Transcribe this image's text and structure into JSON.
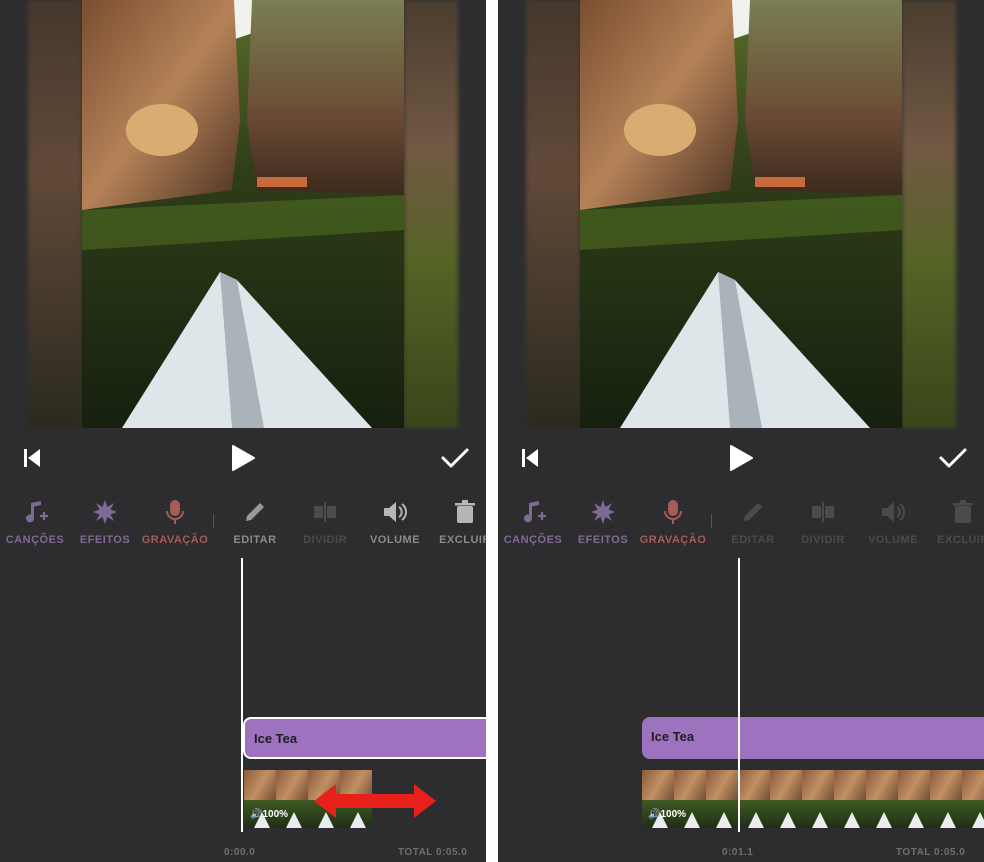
{
  "playback": {
    "skip_icon": "skip-to-start-icon",
    "play_icon": "play-icon",
    "done_icon": "checkmark-icon"
  },
  "toolbar": {
    "items": [
      {
        "label": "CANÇÕES",
        "icon": "music-note-add-icon"
      },
      {
        "label": "EFEITOS",
        "icon": "sparkle-star-icon"
      },
      {
        "label": "GRAVAÇÃO",
        "icon": "microphone-icon"
      },
      {
        "label": "EDITAR",
        "icon": "pencil-icon"
      },
      {
        "label": "DIVIDIR",
        "icon": "split-icon"
      },
      {
        "label": "VOLUME",
        "icon": "speaker-icon"
      },
      {
        "label": "EXCLUIR",
        "icon": "trash-icon"
      }
    ]
  },
  "left_screen": {
    "song_title": "Ice Tea",
    "clip_volume": "🔊100%",
    "current_time": "0:00.0",
    "total_time": "TOTAL 0:05.0"
  },
  "right_screen": {
    "song_title": "Ice Tea",
    "clip_volume": "🔊100%",
    "current_time": "0:01.1",
    "total_time": "TOTAL 0:05.0"
  },
  "colors": {
    "background": "#2d2d2f",
    "song_bar": "#9d72bf",
    "annotation_arrow": "#e8201c"
  }
}
